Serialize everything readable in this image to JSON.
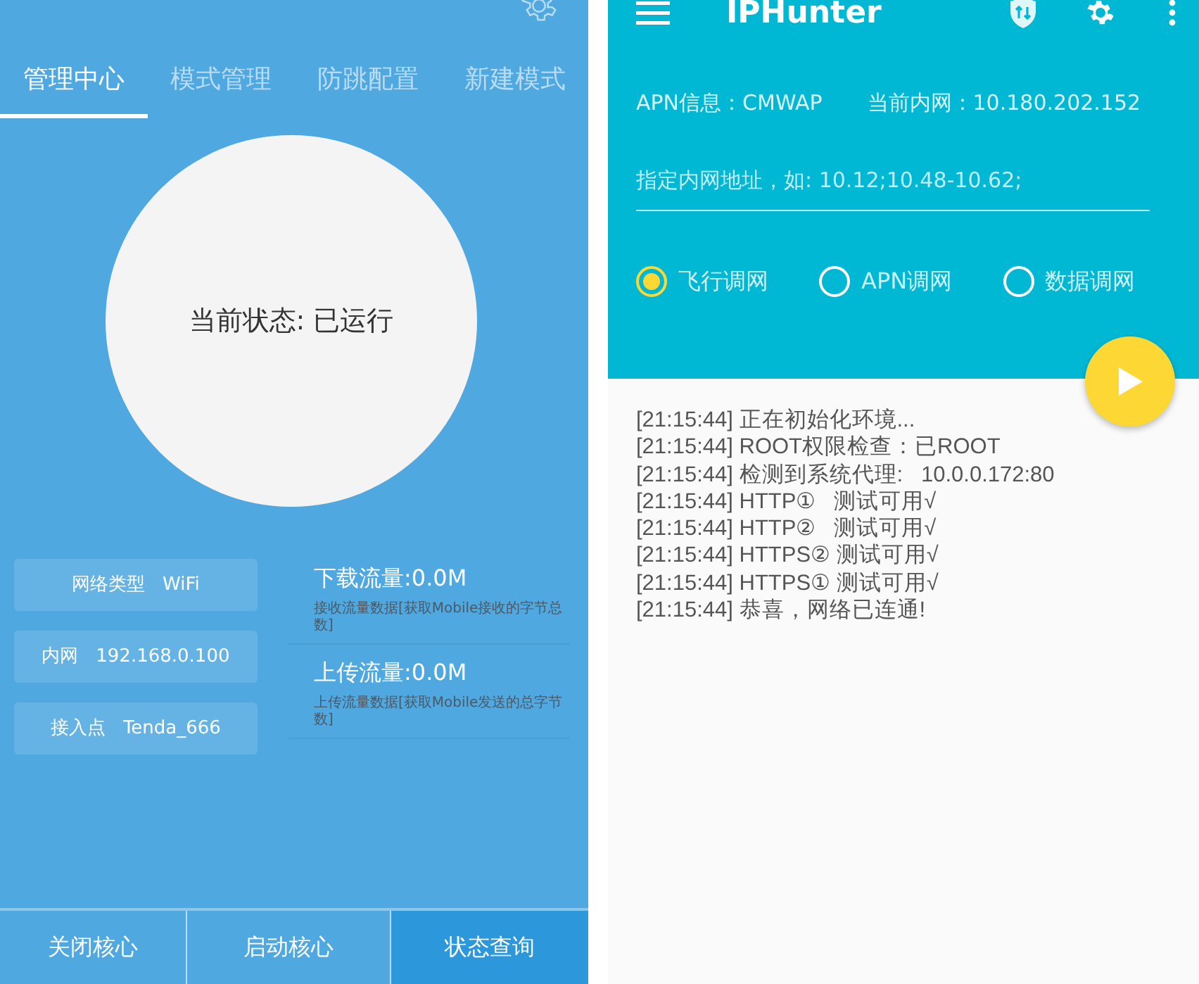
{
  "left": {
    "tabs": [
      {
        "label": "管理中心",
        "selected": true
      },
      {
        "label": "模式管理",
        "selected": false
      },
      {
        "label": "防跳配置",
        "selected": false
      },
      {
        "label": "新建模式",
        "selected": false
      }
    ],
    "status": "当前状态: 已运行",
    "info": [
      "网络类型   WiFi",
      "内网   192.168.0.100",
      "接入点   Tenda_666"
    ],
    "traffic": [
      {
        "title": "下载流量:0.0M",
        "desc": "接收流量数据[获取Mobile接收的字节总数]"
      },
      {
        "title": "上传流量:0.0M",
        "desc": "上传流量数据[获取Mobile发送的总字节数]"
      }
    ],
    "buttons": [
      {
        "label": "关闭核心",
        "selected": false
      },
      {
        "label": "启动核心",
        "selected": false
      },
      {
        "label": "状态查询",
        "selected": true
      }
    ]
  },
  "right": {
    "title": "IPHunter",
    "apn": "APN信息：CMWAP",
    "intranet": "当前内网：10.180.202.152",
    "field": {
      "placeholder": "指定内网地址，如: 10.12;10.48-10.62;"
    },
    "radios": [
      {
        "label": "飞行调网",
        "selected": true
      },
      {
        "label": "APN调网",
        "selected": false
      },
      {
        "label": "数据调网",
        "selected": false
      }
    ],
    "log": [
      "[21:15:44] 正在初始化环境...",
      "[21:15:44] ROOT权限检查：已ROOT",
      "[21:15:44] 检测到系统代理:   10.0.0.172:80",
      "[21:15:44] HTTP①   测试可用√",
      "[21:15:44] HTTP②   测试可用√",
      "[21:15:44] HTTPS② 测试可用√",
      "[21:15:44] HTTPS① 测试可用√",
      "[21:15:44] 恭喜，网络已连通!"
    ]
  }
}
